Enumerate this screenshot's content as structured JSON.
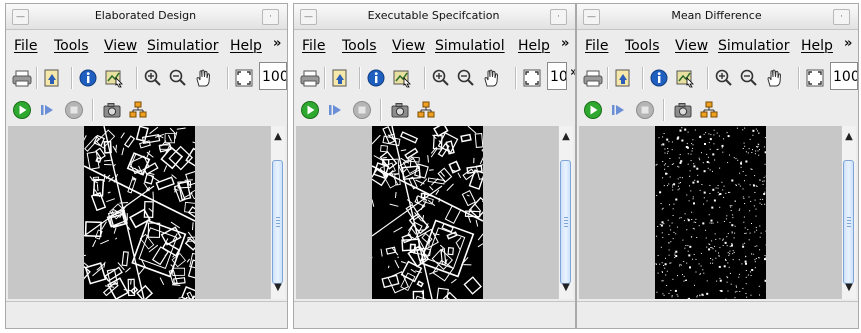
{
  "windows": [
    {
      "title": "Elaborated Design",
      "menu": [
        "File",
        "Tools",
        "View",
        "Simulatior",
        "Help"
      ],
      "menu_more": "»",
      "zoom_value": "100",
      "toolbar_more": "",
      "image_kind": "dense-edges"
    },
    {
      "title": "Executable Specifcation",
      "menu": [
        "File",
        "Tools",
        "View",
        "Simulatiol",
        "Help"
      ],
      "menu_more": "»",
      "zoom_value": "10",
      "toolbar_more": "»",
      "image_kind": "dense-edges"
    },
    {
      "title": "Mean Difference",
      "menu": [
        "File",
        "Tools",
        "View",
        "Simulatior",
        "Help"
      ],
      "menu_more": "»",
      "zoom_value": "100",
      "toolbar_more": "",
      "image_kind": "sparse-speckle"
    }
  ],
  "toolbar_icons": [
    "print-icon",
    "import-icon",
    "info-icon",
    "data-cursor-icon",
    "zoom-in-icon",
    "zoom-out-icon",
    "pan-hand-icon",
    "fit-to-view-icon"
  ],
  "sim_icons": [
    "run-icon",
    "step-forward-icon",
    "stop-icon",
    "snapshot-camera-icon",
    "signal-selector-icon"
  ],
  "colors": {
    "window_bg": "#ececec",
    "viewport_bg": "#c7c7c7",
    "image_bg": "#000000",
    "edge_pixels": "#ffffff",
    "run_green": "#2fa82f",
    "info_blue": "#1f5fbf",
    "scroll_thumb": "#cde1fb"
  }
}
